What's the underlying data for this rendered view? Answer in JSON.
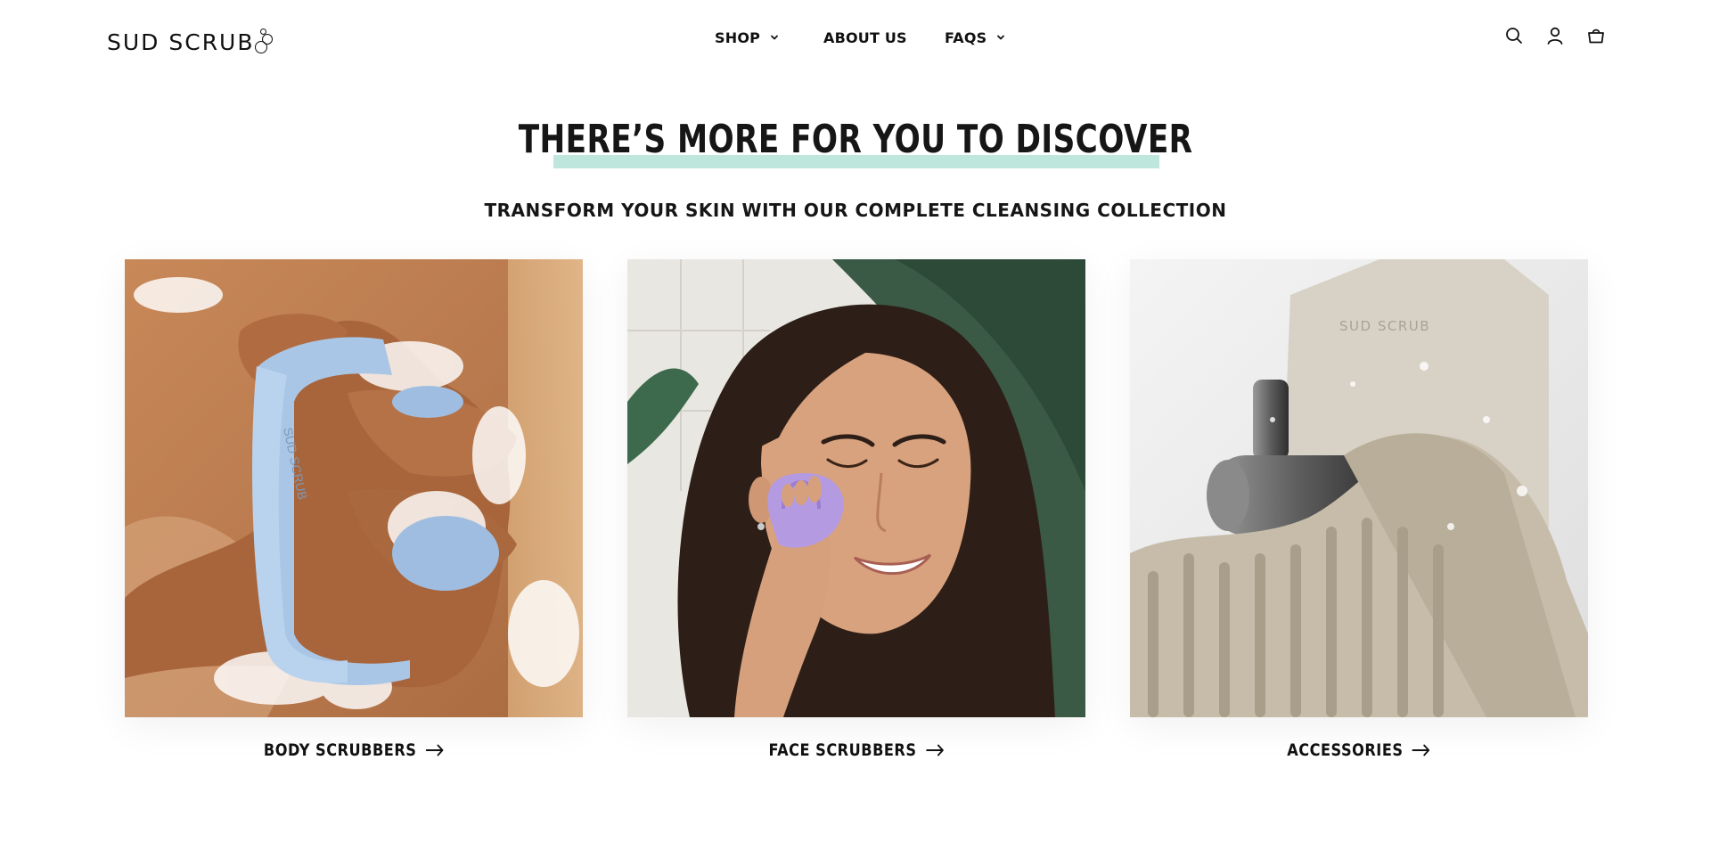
{
  "brand": {
    "name": "SUD SCRUB"
  },
  "nav": {
    "items": [
      {
        "label": "SHOP",
        "has_dropdown": true
      },
      {
        "label": "ABOUT US",
        "has_dropdown": false
      },
      {
        "label": "FAQS",
        "has_dropdown": true
      }
    ]
  },
  "header_icons": [
    "search-icon",
    "account-icon",
    "cart-icon"
  ],
  "section": {
    "title": "THERE’S MORE FOR YOU TO DISCOVER",
    "subtitle": "TRANSFORM YOUR SKIN WITH OUR COMPLETE CLEANSING COLLECTION",
    "highlight_color": "#bfe6dc"
  },
  "cards": [
    {
      "label": "BODY SCRUBBERS",
      "image": "body-scrubber-photo"
    },
    {
      "label": "FACE SCRUBBERS",
      "image": "face-scrubber-photo"
    },
    {
      "label": "ACCESSORIES",
      "image": "accessories-photo"
    }
  ],
  "product_marks": {
    "imprint": "SUD SCRUB"
  }
}
